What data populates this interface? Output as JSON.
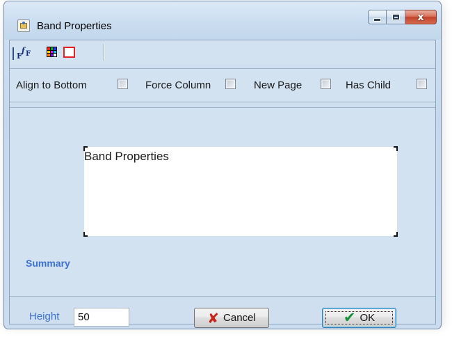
{
  "window": {
    "title": "Band Properties",
    "caption": {
      "minimize": "minimize",
      "maximize": "maximize",
      "close": "x"
    }
  },
  "toolbar": {
    "font_icon": {
      "a": "F",
      "b": "f",
      "c": "F"
    }
  },
  "options": [
    {
      "label": "Align to Bottom",
      "checked": false
    },
    {
      "label": "Force Column",
      "checked": false
    },
    {
      "label": "New Page",
      "checked": false
    },
    {
      "label": "Has Child",
      "checked": false
    }
  ],
  "band": {
    "preview_text": "Band Properties",
    "section_label": "Summary"
  },
  "footer": {
    "height_label": "Height",
    "height_value": "50",
    "cancel_label": "Cancel",
    "ok_label": "OK"
  },
  "colors": {
    "accent_label": "#3a72d4",
    "border_icon": "#e52222",
    "palette": [
      "#ff1a1a",
      "#00b300",
      "#1a3dff",
      "#ffd400",
      "#ff00ff",
      "#00c8ff",
      "#ff7a00",
      "#7a00ff",
      "#ffffff"
    ]
  }
}
